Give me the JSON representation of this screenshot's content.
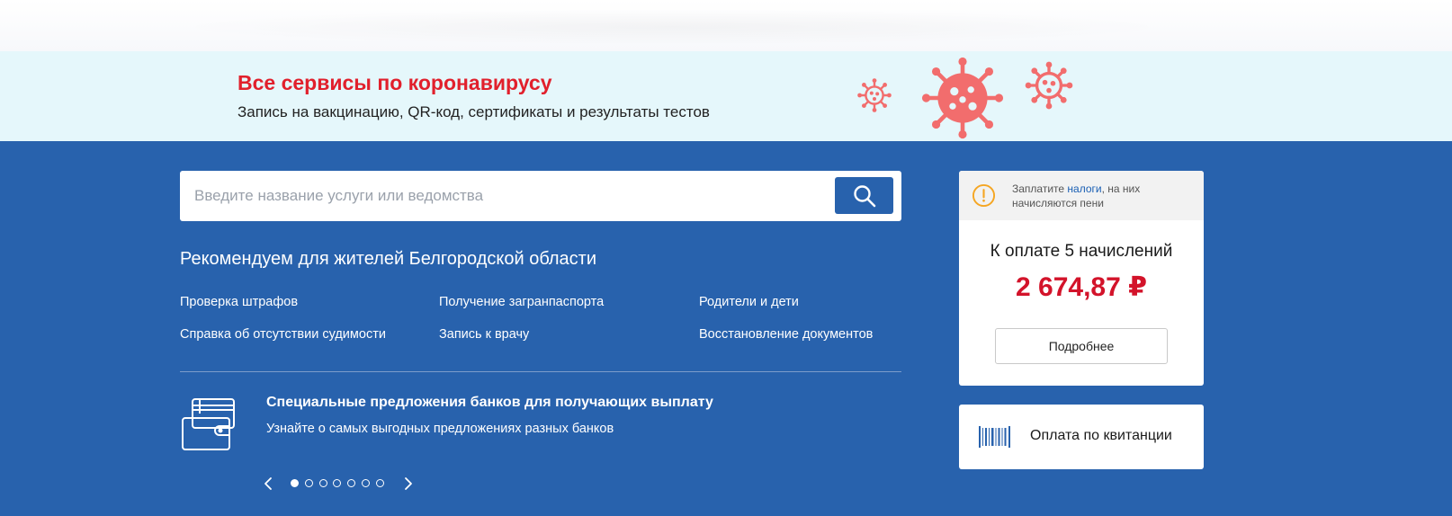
{
  "covid": {
    "title": "Все сервисы по коронавирусу",
    "subtitle": "Запись на вакцинацию, QR-код, сертификаты и результаты тестов"
  },
  "search": {
    "placeholder": "Введите название услуги или ведомства",
    "value": ""
  },
  "recommend": {
    "title": "Рекомендуем для жителей Белгородской области",
    "links": [
      "Проверка штрафов",
      "Получение загранпаспорта",
      "Родители и дети",
      "Справка об отсутствии судимости",
      "Запись к врачу",
      "Восстановление документов"
    ]
  },
  "promo": {
    "title": "Специальные предложения банков для получающих выплату",
    "subtitle": "Узнайте о самых выгодных предложениях разных банков",
    "slides_total": 7,
    "active_slide": 1
  },
  "tax": {
    "warning_prefix": "Заплатите ",
    "warning_link": "налоги",
    "warning_suffix": ", на них начисляются пени",
    "label": "К оплате 5 начислений",
    "amount": "2 674,87 ₽",
    "details_button": "Подробнее"
  },
  "receipt": {
    "label": "Оплата по квитанции"
  },
  "icons": {
    "search": "search-icon",
    "virus": "virus-icon",
    "wallet": "wallet-cards-icon",
    "warning": "warning-circle-icon",
    "barcode": "barcode-icon",
    "prev": "chevron-left-icon",
    "next": "chevron-right-icon"
  },
  "colors": {
    "brand_blue": "#2862ad",
    "covid_red": "#e1202c",
    "virus_coral": "#f26d6d",
    "banner_bg": "#e5f7fb",
    "amount_red": "#d3132a",
    "warning_orange": "#f5a623"
  }
}
